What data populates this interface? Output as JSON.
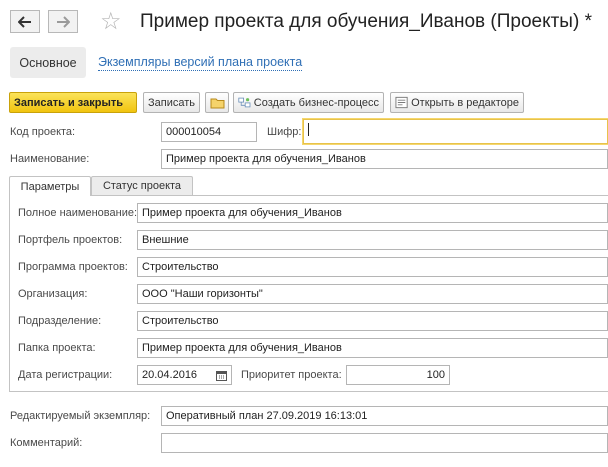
{
  "window": {
    "title": "Пример проекта для обучения_Иванов (Проекты) *"
  },
  "sections": {
    "main": "Основное",
    "link": "Экземпляры версий плана проекта"
  },
  "toolbar": {
    "save_close": "Записать и закрыть",
    "save": "Записать",
    "create_process": "Создать бизнес-процесс",
    "open_editor": "Открыть в редакторе"
  },
  "header_fields": {
    "code_label": "Код проекта:",
    "code_value": "000010054",
    "cipher_label": "Шифр:",
    "cipher_value": "",
    "name_label": "Наименование:",
    "name_value": "Пример проекта для обучения_Иванов"
  },
  "tabs": [
    {
      "label": "Параметры",
      "active": true
    },
    {
      "label": "Статус проекта",
      "active": false
    }
  ],
  "params": {
    "full_name_label": "Полное наименование:",
    "full_name_value": "Пример проекта для обучения_Иванов",
    "portfolio_label": "Портфель проектов:",
    "portfolio_value": "Внешние",
    "program_label": "Программа проектов:",
    "program_value": "Строительство",
    "org_label": "Организация:",
    "org_value": "ООО \"Наши горизонты\"",
    "division_label": "Подразделение:",
    "division_value": "Строительство",
    "folder_label": "Папка проекта:",
    "folder_value": "Пример проекта для обучения_Иванов",
    "reg_date_label": "Дата регистрации:",
    "reg_date_value": "20.04.2016",
    "priority_label": "Приоритет проекта:",
    "priority_value": "100"
  },
  "footer_fields": {
    "instance_label": "Редактируемый экземпляр:",
    "instance_value": "Оперативный план 27.09.2019 16:13:01",
    "comment_label": "Комментарий:",
    "comment_value": ""
  },
  "colors": {
    "accent": "#f1c40f",
    "link": "#2f6fb5"
  }
}
